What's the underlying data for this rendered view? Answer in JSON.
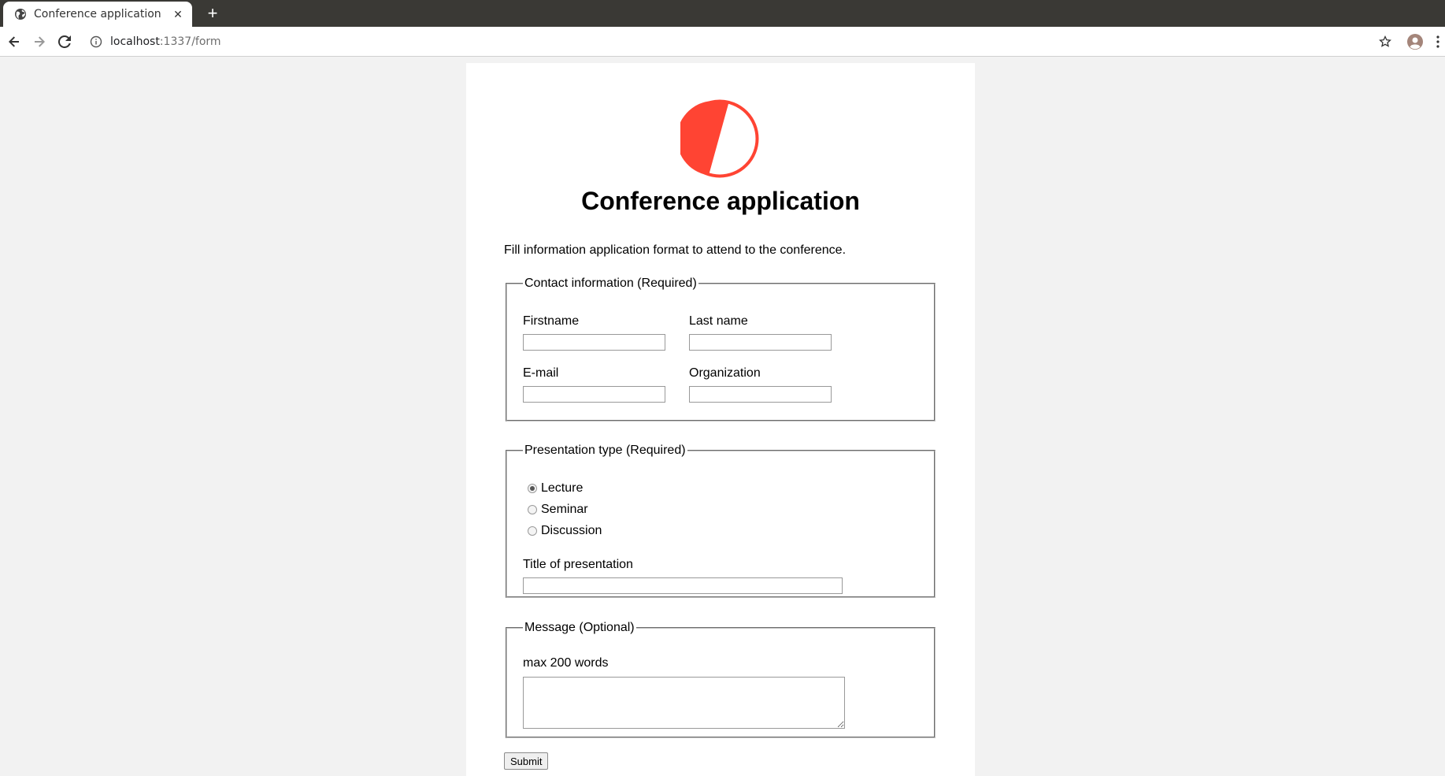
{
  "browser": {
    "tab_title": "Conference application",
    "new_tab_symbol": "+",
    "close_symbol": "✕",
    "url_host": "localhost",
    "url_path": ":1337/form"
  },
  "page": {
    "title": "Conference application",
    "intro": "Fill information application format to attend to the conference.",
    "brand_color": "#ff4433",
    "contact": {
      "legend": "Contact information (Required)",
      "firstname_label": "Firstname",
      "lastname_label": "Last name",
      "email_label": "E-mail",
      "organization_label": "Organization",
      "firstname_value": "",
      "lastname_value": "",
      "email_value": "",
      "organization_value": ""
    },
    "presentation": {
      "legend": "Presentation type (Required)",
      "options": [
        "Lecture",
        "Seminar",
        "Discussion"
      ],
      "selected": "Lecture",
      "title_label": "Title of presentation",
      "title_value": ""
    },
    "message": {
      "legend": "Message (Optional)",
      "hint": "max 200 words",
      "value": ""
    },
    "submit_label": "Submit"
  }
}
